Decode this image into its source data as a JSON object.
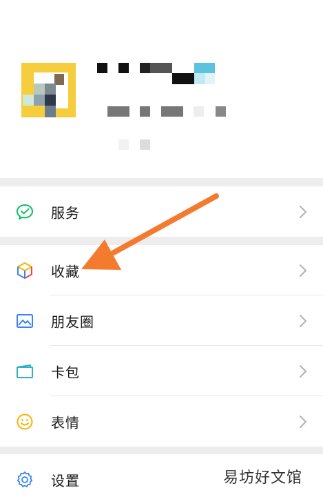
{
  "menu": {
    "services": {
      "label": "服务",
      "icon": "services-icon"
    },
    "favorites": {
      "label": "收藏",
      "icon": "favorites-cube-icon"
    },
    "moments": {
      "label": "朋友圈",
      "icon": "moments-image-icon"
    },
    "cards": {
      "label": "卡包",
      "icon": "card-wallet-icon"
    },
    "stickers": {
      "label": "表情",
      "icon": "smiley-icon"
    },
    "settings": {
      "label": "设置",
      "icon": "gear-icon"
    }
  },
  "watermark": "易坊好文馆",
  "colors": {
    "green": "#07c160",
    "arrow": "#f47a2e",
    "chevron": "#b2b2b2",
    "divider": "#e8e8e8"
  }
}
